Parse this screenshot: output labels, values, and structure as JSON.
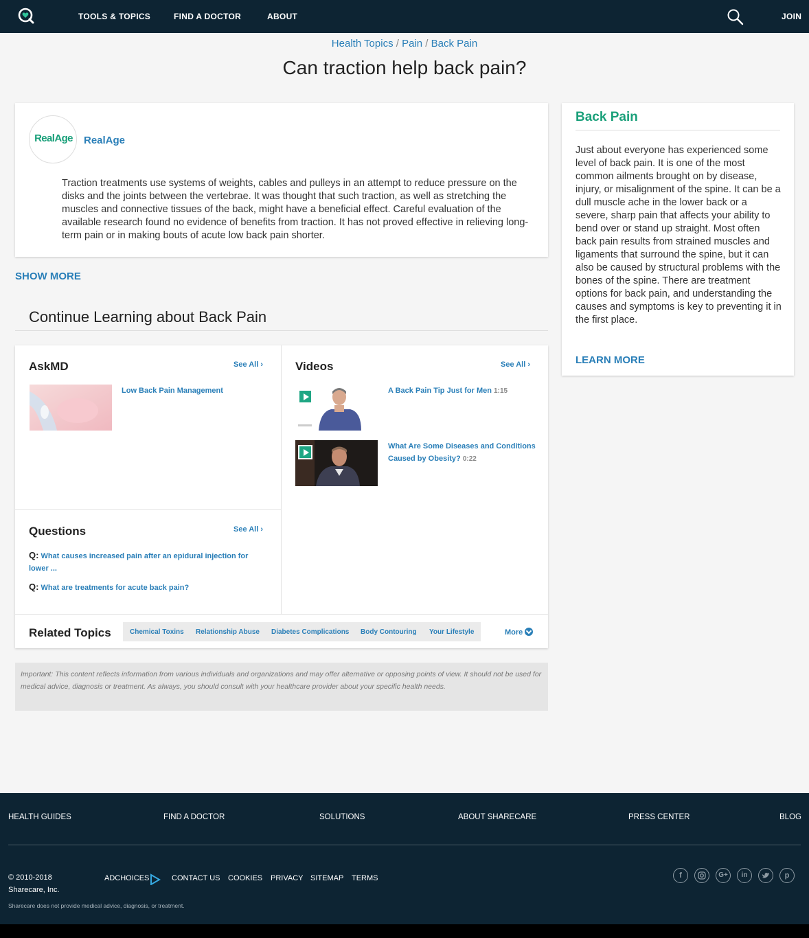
{
  "nav": {
    "items": [
      "TOOLS & TOPICS",
      "FIND A DOCTOR",
      "ABOUT"
    ],
    "join": "JOIN",
    "icons": {
      "logo": "sharecare-heart-icon",
      "search": "search-icon"
    }
  },
  "breadcrumb": {
    "items": [
      "Health Topics",
      "Pain",
      "Back Pain"
    ],
    "sep": " / "
  },
  "page_title": "Can traction help back pain?",
  "answer": {
    "avatar_text": "RealAge",
    "author": "RealAge",
    "text": "Traction treatments use systems of weights, cables and pulleys in an attempt to reduce pressure on the disks and the joints between the vertebrae. It was thought that such traction, as well as stretching the muscles and connective tissues of the back, might have a beneficial effect. Careful evaluation of the available research found no evidence of benefits from traction. It has not proved effective in relieving long-term pain or in making bouts of acute low back pain shorter."
  },
  "show_more": "SHOW MORE",
  "continue_title": "Continue Learning about Back Pain",
  "askmd": {
    "title": "AskMD",
    "see_all": "See All",
    "items": [
      {
        "title": "Low Back Pain Management"
      }
    ]
  },
  "videos": {
    "title": "Videos",
    "see_all": "See All",
    "items": [
      {
        "title": "A Back Pain Tip Just for Men",
        "duration": "1:15"
      },
      {
        "title": "What Are Some Diseases and Conditions Caused by Obesity?",
        "duration": "0:22"
      }
    ]
  },
  "questions": {
    "title": "Questions",
    "see_all": "See All",
    "label": "Q:",
    "items": [
      "What causes increased pain after an epidural injection for lower ...",
      "What are treatments for acute back pain?"
    ]
  },
  "related": {
    "title": "Related Topics",
    "chips": [
      "Chemical Toxins",
      "Relationship Abuse",
      "Diabetes Complications",
      "Body Contouring",
      "Your Lifestyle"
    ],
    "more": "More"
  },
  "disclaimer": "Important: This content reflects information from various individuals and organizations and may offer alternative or opposing points of view. It should not be used for medical advice, diagnosis or treatment. As always, you should consult with your healthcare provider about your specific health needs.",
  "sidebar": {
    "title": "Back Pain",
    "text": "Just about everyone has experienced some level of back pain. It is one of the most common ailments brought on by disease, injury, or misalignment of the spine. It can be a dull muscle ache in the lower back or a severe, sharp pain that affects your ability to bend over or stand up straight. Most often back pain results from strained muscles and ligaments that surround the spine, but it can also be caused by structural problems with the bones of the spine. There are treatment options for back pain, and understanding the causes and symptoms is key to preventing it in the first place.",
    "learn_more": "LEARN MORE"
  },
  "footer": {
    "links": [
      "HEALTH GUIDES",
      "FIND A DOCTOR",
      "SOLUTIONS",
      "ABOUT SHARECARE",
      "PRESS CENTER",
      "BLOG"
    ],
    "copyright_line1": "© 2010-2018",
    "copyright_line2": "Sharecare, Inc.",
    "small_links": [
      "ADCHOICES",
      "CONTACT US",
      "COOKIES",
      "PRIVACY",
      "SITEMAP",
      "TERMS"
    ],
    "note": "Sharecare does not provide medical advice, diagnosis, or treatment.",
    "social_icons": [
      "facebook-icon",
      "instagram-icon",
      "google-plus-icon",
      "linkedin-icon",
      "twitter-icon",
      "pinterest-icon"
    ]
  },
  "colors": {
    "nav_bg": "#0d2433",
    "link": "#2a7fb8",
    "accent_green": "#1aa07a"
  }
}
